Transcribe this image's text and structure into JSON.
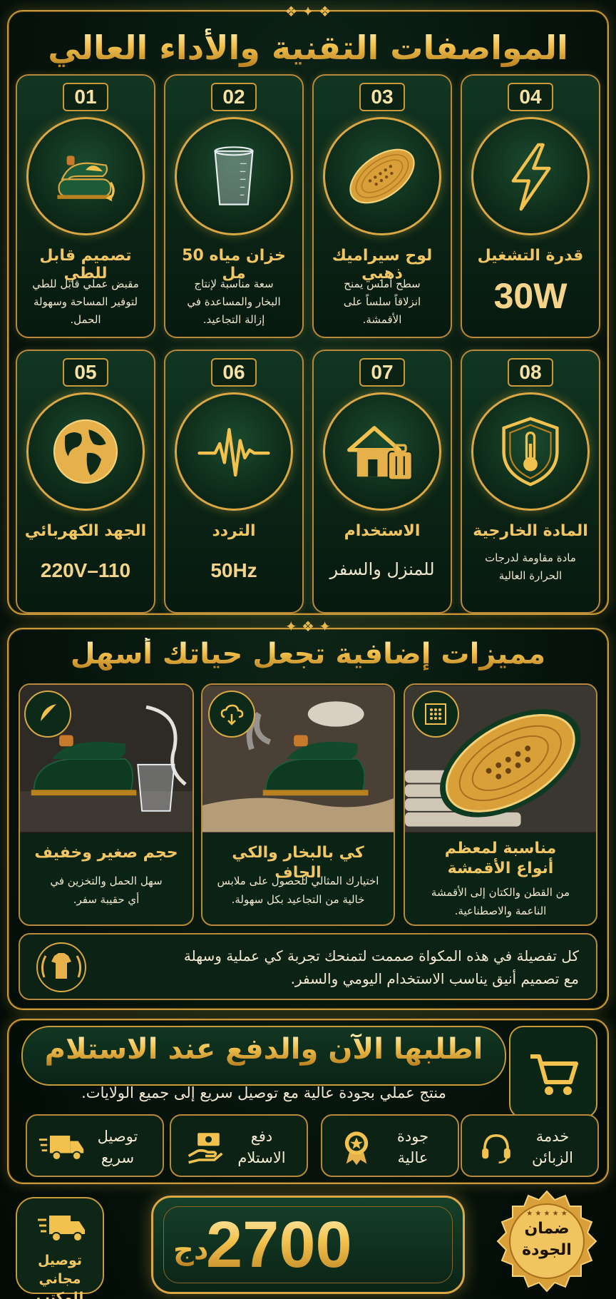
{
  "colors": {
    "gold": "#f3c664",
    "deep_green": "#0a2315",
    "border_gold": "#c99a3a"
  },
  "specs": {
    "title": "المواصفات التقنية والأداء العالي",
    "cards": [
      {
        "num": "01",
        "title": "تصميم قابل للطي",
        "icon": "foldable-iron-icon",
        "desc": [
          "مقبض عملي قابل للطي",
          "لتوفير المساحة وسهولة",
          "الحمل."
        ]
      },
      {
        "num": "02",
        "title": "خزان مياه 50 مل",
        "icon": "water-cup-icon",
        "desc": [
          "سعة مناسبة لإنتاج",
          "البخار والمساعدة في",
          "إزالة التجاعيد."
        ]
      },
      {
        "num": "03",
        "title": "لوح سيراميك ذهبي",
        "icon": "ceramic-plate-icon",
        "desc": [
          "سطح أملس يمنح",
          "انزلاقاً سلساً على",
          "الأقمشة."
        ]
      },
      {
        "num": "04",
        "title": "قدرة التشغيل",
        "icon": "lightning-icon",
        "value": "30W"
      },
      {
        "num": "05",
        "title": "الجهد الكهربائي",
        "icon": "globe-icon",
        "value": "110–220V"
      },
      {
        "num": "06",
        "title": "التردد",
        "icon": "pulse-wave-icon",
        "value": "50Hz"
      },
      {
        "num": "07",
        "title": "الاستخدام",
        "icon": "house-luggage-icon",
        "value": "للمنزل والسفر"
      },
      {
        "num": "08",
        "title": "المادة الخارجية",
        "icon": "shield-thermometer-icon",
        "desc": [
          "مادة مقاومة لدرجات",
          "الحرارة العالية"
        ]
      }
    ]
  },
  "extras": {
    "title": "مميزات إضافية تجعل حياتك أسهل",
    "cards": [
      {
        "title_lines": [
          "مناسبة لمعظم",
          "أنواع الأقمشة"
        ],
        "icon": "fabric-grid-icon",
        "desc": [
          "من القطن والكتان إلى الأقمشة",
          "الناعمة والاصطناعية."
        ]
      },
      {
        "title_lines": [
          "كي بالبخار والكي الجاف"
        ],
        "icon": "steam-cloud-icon",
        "desc": [
          "اختيارك المثالي للحصول على ملابس",
          "خالية من التجاعيد بكل سهولة."
        ]
      },
      {
        "title_lines": [
          "حجم صغير وخفيف"
        ],
        "icon": "feather-icon",
        "desc": [
          "سهل الحمل والتخزين في",
          "أي حقيبة سفر."
        ]
      }
    ],
    "summary": [
      "كل تفصيلة في هذه المكواة صممت لتمنحك تجربة كي عملية وسهلة",
      "مع تصميم أنيق يناسب الاستخدام اليومي والسفر."
    ]
  },
  "order": {
    "title": "اطلبها الآن والدفع عند الاستلام",
    "subtitle": "منتج عملي بجودة عالية مع توصيل سريع إلى جميع الولايات.",
    "services": [
      {
        "lines": [
          "خدمة",
          "الزبائن"
        ],
        "icon": "headset-icon"
      },
      {
        "lines": [
          "جودة",
          "عالية"
        ],
        "icon": "medal-icon"
      },
      {
        "lines": [
          "دفع",
          "الاستلام"
        ],
        "icon": "cash-hand-icon"
      },
      {
        "lines": [
          "توصيل",
          "سريع"
        ],
        "icon": "delivery-truck-icon"
      }
    ]
  },
  "price": {
    "value": "2700",
    "currency": "دج"
  },
  "free_delivery": {
    "lines": [
      "توصيل مجاني",
      "للمكتب"
    ]
  },
  "quality_seal": {
    "lines": [
      "ضمان",
      "الجودة"
    ]
  }
}
